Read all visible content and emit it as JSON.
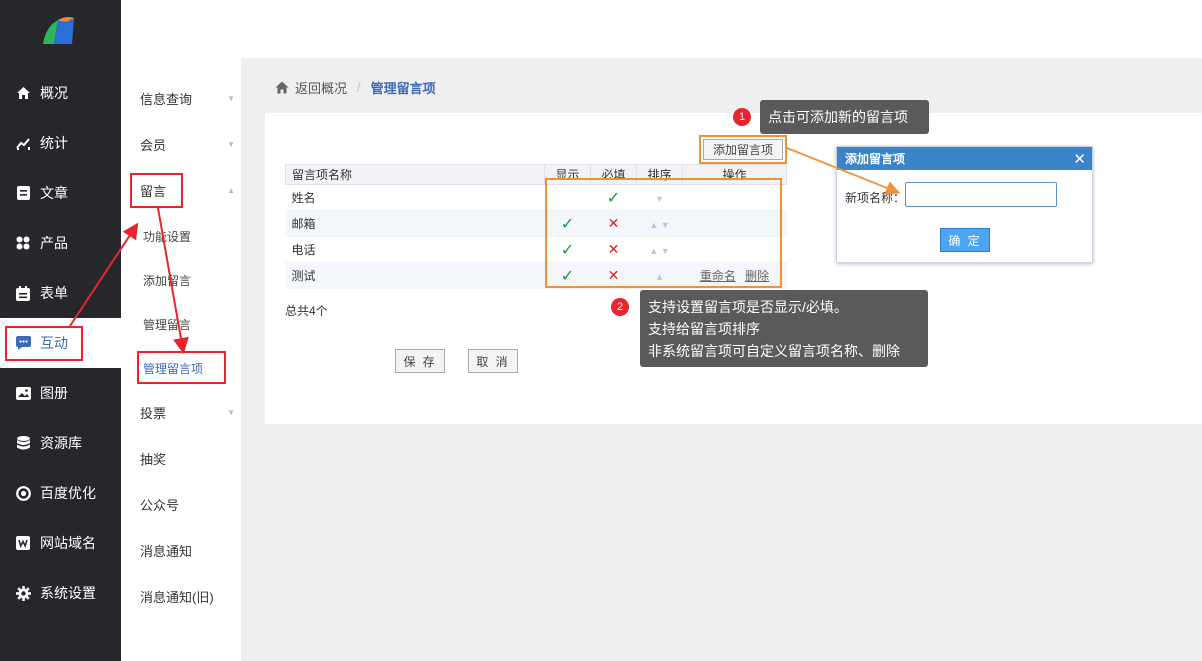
{
  "sidebar": {
    "items": [
      {
        "label": "概况",
        "icon": "home-icon"
      },
      {
        "label": "统计",
        "icon": "chart-icon"
      },
      {
        "label": "文章",
        "icon": "article-icon"
      },
      {
        "label": "产品",
        "icon": "grid-icon"
      },
      {
        "label": "表单",
        "icon": "calendar-icon"
      },
      {
        "label": "互动",
        "icon": "chat-icon"
      },
      {
        "label": "图册",
        "icon": "album-icon"
      },
      {
        "label": "资源库",
        "icon": "database-icon"
      },
      {
        "label": "百度优化",
        "icon": "target-icon"
      },
      {
        "label": "网站域名",
        "icon": "w-icon"
      },
      {
        "label": "系统设置",
        "icon": "gear-icon"
      }
    ],
    "active_color": "#3d6ab4"
  },
  "submenu": {
    "items": [
      "信息查询",
      "会员",
      "留言"
    ],
    "subitems": [
      "功能设置",
      "添加留言",
      "管理留言",
      "管理留言项"
    ],
    "more": [
      "投票",
      "抽奖",
      "公众号",
      "消息通知",
      "消息通知(旧)"
    ]
  },
  "breadcrumb": {
    "back": "返回概况",
    "sep": "/",
    "current": "管理留言项"
  },
  "toolbar": {
    "add_label": "添加留言项"
  },
  "table": {
    "headers": [
      "留言项名称",
      "显示",
      "必填",
      "排序",
      "操作"
    ],
    "rows": [
      {
        "name": "姓名",
        "show": "",
        "required": "✓",
        "sort": "▼",
        "ops": []
      },
      {
        "name": "邮箱",
        "show": "✓",
        "required": "✕",
        "sort": "▲ ▼",
        "ops": []
      },
      {
        "name": "电话",
        "show": "✓",
        "required": "✕",
        "sort": "▲ ▼",
        "ops": []
      },
      {
        "name": "测试",
        "show": "✓",
        "required": "✕",
        "sort": "▲",
        "ops": [
          "重命名",
          "删除"
        ]
      }
    ]
  },
  "total": "总共4个",
  "buttons": {
    "save": "保 存",
    "cancel": "取 消"
  },
  "callouts": {
    "one": {
      "num": "1",
      "text": "点击可添加新的留言项"
    },
    "two": {
      "num": "2",
      "lines": [
        "支持设置留言项是否显示/必填。",
        "支持给留言项排序",
        "非系统留言项可自定义留言项名称、删除"
      ]
    }
  },
  "dialog": {
    "title": "添加留言项",
    "close": "✕",
    "label": "新项名称：",
    "value": "",
    "ok": "确 定"
  },
  "colors": {
    "sidebar_bg": "#26272b",
    "highlight_orange": "#f0913a",
    "highlight_red": "#e8252e",
    "dialog_header": "#3a84c9"
  }
}
